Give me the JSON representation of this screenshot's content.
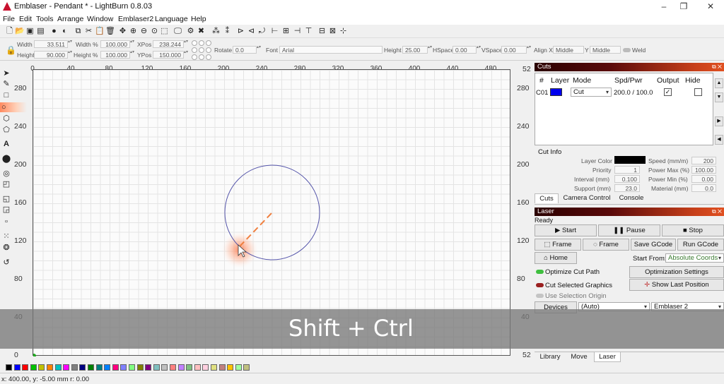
{
  "window": {
    "title": "Emblaser - Pendant * - LightBurn 0.8.03",
    "controls": [
      "–",
      "❐",
      "✕"
    ]
  },
  "menu": [
    "File",
    "Edit",
    "Tools",
    "Arrange",
    "Window",
    "Emblaser2",
    "Language",
    "Help"
  ],
  "props": {
    "width_label": "Width",
    "width": "33.511",
    "height_label": "Height",
    "height": "90.000",
    "widthpct_label": "Width %",
    "widthpct": "100.000",
    "heightpct_label": "Height %",
    "heightpct": "100.000",
    "xpos_label": "XPos",
    "xpos": "238.244",
    "ypos_label": "YPos",
    "ypos": "150.000",
    "rotate_label": "Rotate",
    "rotate": "0.0",
    "font_label": "Font",
    "font": "Arial",
    "theight_label": "Height",
    "theight": "25.00",
    "hspace_label": "HSpace",
    "hspace": "0.00",
    "vspace_label": "VSpace",
    "vspace": "0.00",
    "alignx_label": "Align X",
    "alignx": "Middle",
    "y_label": "Y",
    "aligny": "Middle",
    "weld_label": "Weld"
  },
  "ruler": {
    "top": [
      "0",
      "40",
      "80",
      "120",
      "160",
      "200",
      "240",
      "280",
      "320",
      "360",
      "400",
      "440",
      "480"
    ],
    "left": [
      "280",
      "240",
      "200",
      "160",
      "120",
      "80",
      "40",
      "0"
    ],
    "right": [
      "52",
      "280",
      "240",
      "200",
      "160",
      "120",
      "80",
      "40",
      "52"
    ]
  },
  "cuts": {
    "title": "Cuts",
    "headers": [
      "#",
      "Layer",
      "Mode",
      "Spd/Pwr",
      "Output",
      "Hide"
    ],
    "row": {
      "id": "C01",
      "color": "#0000ee",
      "mode": "Cut",
      "spdpwr": "200.0 / 100.0"
    }
  },
  "cutinfo": {
    "title": "Cut Info",
    "layer_color_label": "Layer Color",
    "priority_label": "Priority",
    "priority": "1",
    "interval_label": "Interval (mm)",
    "interval": "0.100",
    "support_label": "Support (mm)",
    "support": "23.0",
    "speed_label": "Speed (mm/m)",
    "speed": "200",
    "pmax_label": "Power Max (%)",
    "pmax": "100.00",
    "pmin_label": "Power Min (%)",
    "pmin": "0.00",
    "material_label": "Material (mm)",
    "material": "0.0"
  },
  "tabs_top": [
    "Cuts",
    "Camera Control",
    "Console"
  ],
  "laser": {
    "title": "Laser",
    "status": "Ready",
    "start": "Start",
    "pause": "Pause",
    "stop": "Stop",
    "frame1": "Frame",
    "frame2": "Frame",
    "save_gcode": "Save GCode",
    "run_gcode": "Run GCode",
    "home": "Home",
    "start_from_label": "Start From:",
    "start_from": "Absolute Coords",
    "optimize_label": "Optimize Cut Path",
    "opt_settings": "Optimization Settings",
    "cut_selected_label": "Cut Selected Graphics",
    "show_last": "Show Last Position",
    "use_selection_label": "Use Selection Origin",
    "devices": "Devices",
    "port": "(Auto)",
    "device": "Emblaser 2"
  },
  "tabs_bottom": [
    "Library",
    "Move",
    "Laser"
  ],
  "palette": [
    "#000000",
    "#0000ff",
    "#ff0000",
    "#00c000",
    "#c0c000",
    "#ff8000",
    "#00c0c0",
    "#ff00ff",
    "#808080",
    "#000080",
    "#008000",
    "#008080",
    "#0080ff",
    "#ff0080",
    "#8080ff",
    "#80ff80",
    "#808000",
    "#800080",
    "#80c0c0",
    "#c0c0c0",
    "#ff8080",
    "#c080ff",
    "#80c080",
    "#ffc0c0",
    "#ffd0e0",
    "#e0e080",
    "#c08080",
    "#ffc000",
    "#a0ffa0",
    "#c0c080"
  ],
  "statusbar": "x: 400.00, y: -5.00 mm  r: 0.00",
  "overlay": "Shift + Ctrl",
  "colors": {
    "shape": "#5555aa",
    "accent": "#e06020"
  }
}
